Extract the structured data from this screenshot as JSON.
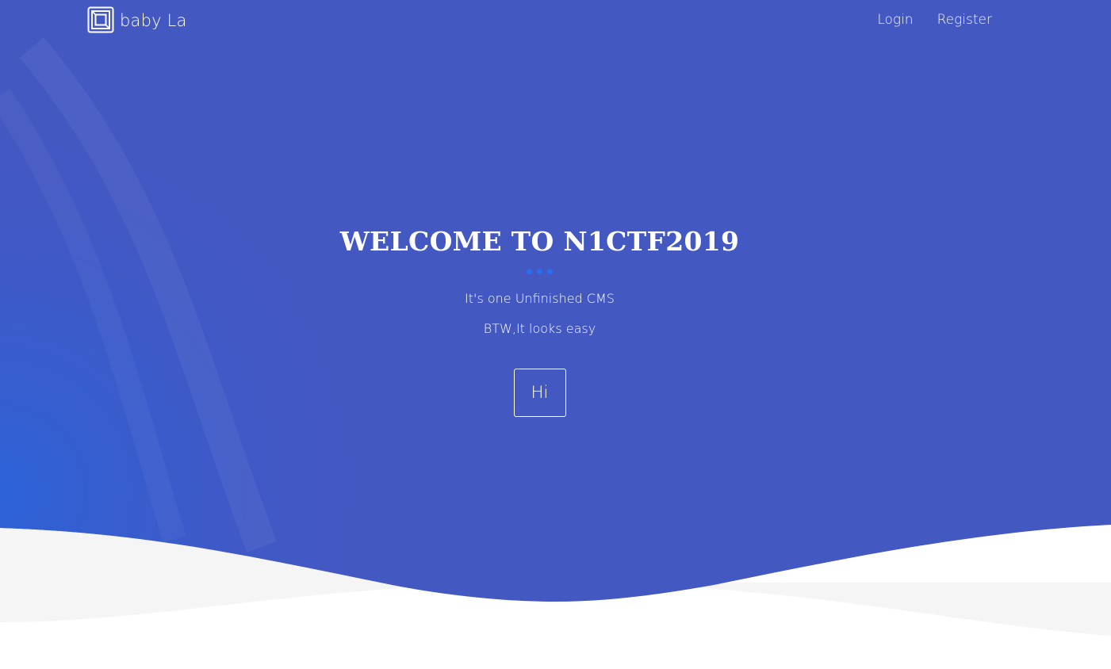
{
  "nav": {
    "brand_text": "baby La",
    "brand_icon": "book-frame-icon",
    "links": [
      {
        "label": "Login"
      },
      {
        "label": "Register"
      }
    ]
  },
  "hero": {
    "title": "WELCOME TO N1CTF2019",
    "lines": [
      "It's one Unfinished CMS",
      "BTW,It looks easy"
    ],
    "button_label": "Hi",
    "decoration_icon": "three-dots-icon"
  },
  "colors": {
    "hero_primary": "#4458c2",
    "hero_left_glow": "#2c63d8",
    "wave_gray": "#f5f5f5",
    "page_bg": "#ffffff",
    "dots": "#2a6df0",
    "text": "#ffffff"
  }
}
